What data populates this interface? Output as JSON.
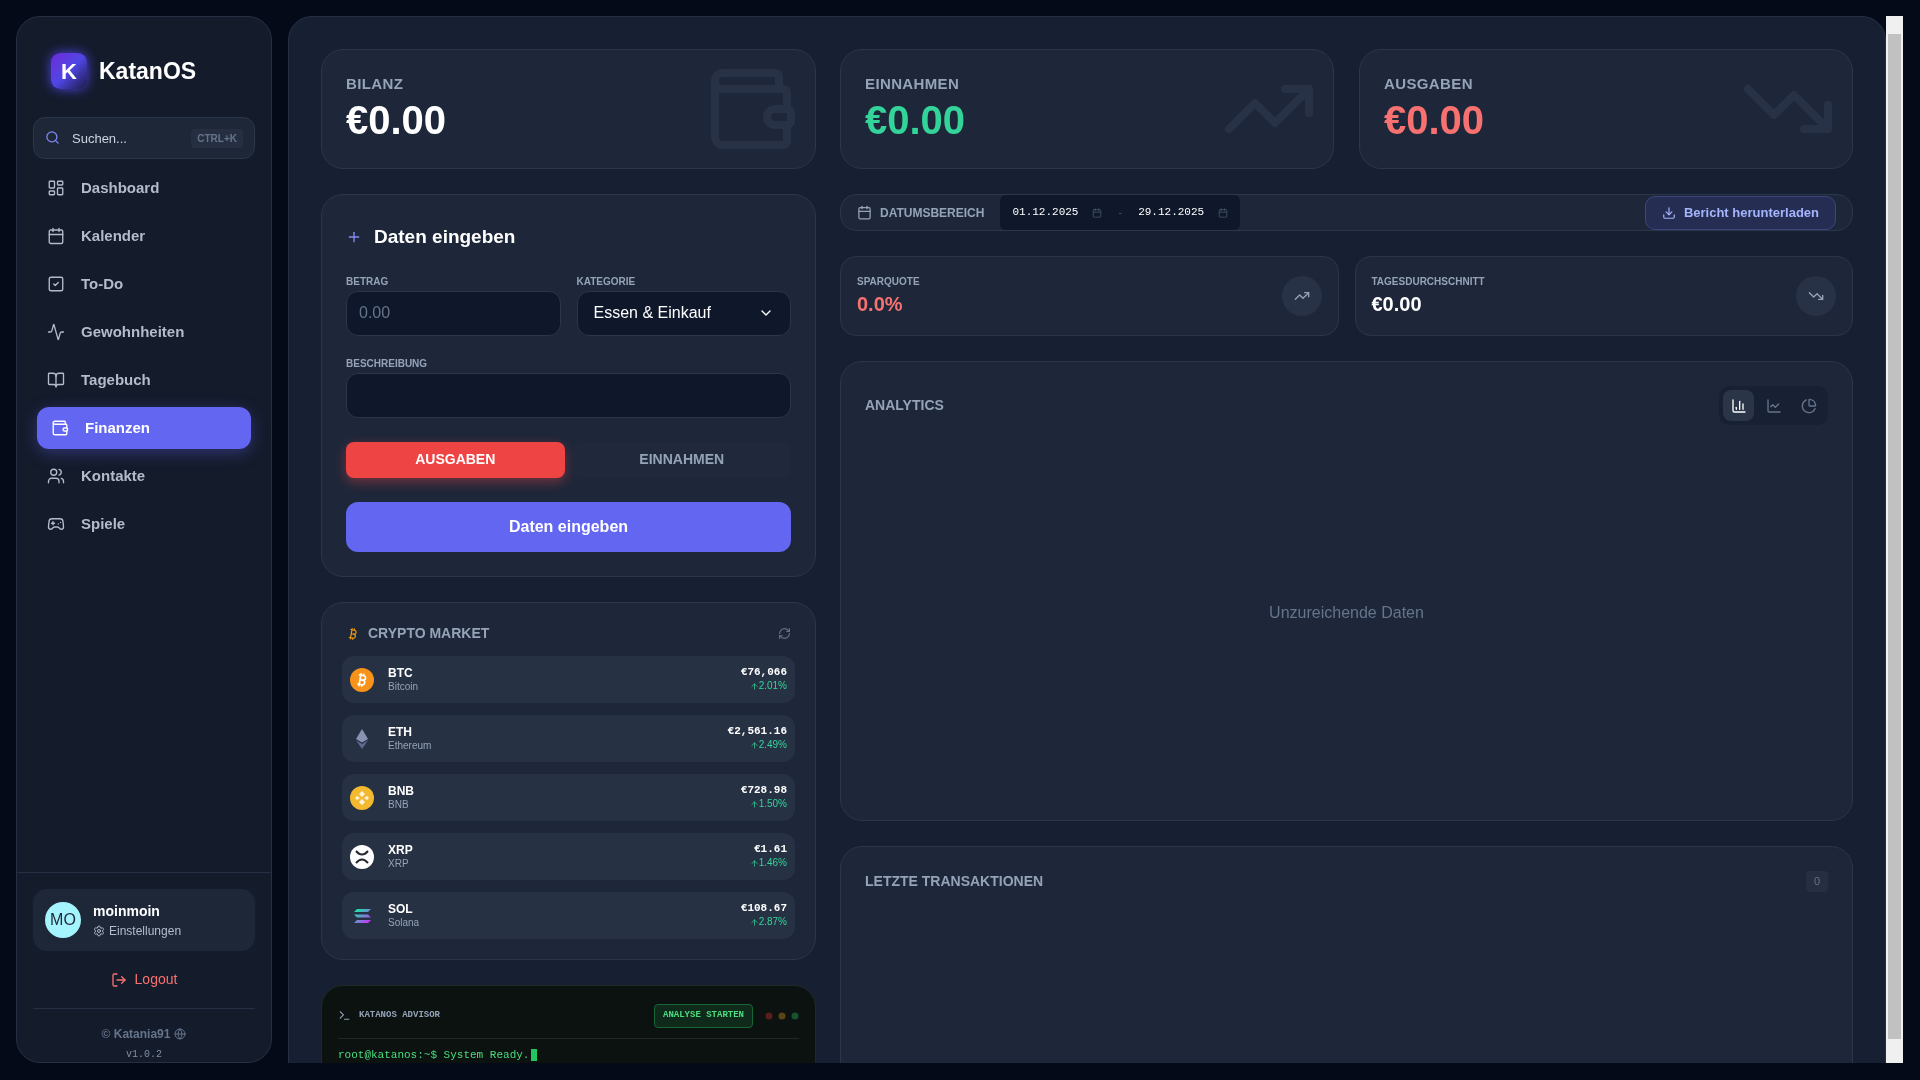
{
  "sidebar": {
    "brand": {
      "mark": "K",
      "name": "KatanOS"
    },
    "search": {
      "placeholder": "Suchen...",
      "shortcut": "CTRL+K"
    },
    "items": [
      {
        "label": "Dashboard",
        "selected": false
      },
      {
        "label": "Kalender",
        "selected": false
      },
      {
        "label": "To-Do",
        "selected": false
      },
      {
        "label": "Gewohnheiten",
        "selected": false
      },
      {
        "label": "Tagebuch",
        "selected": false
      },
      {
        "label": "Finanzen",
        "selected": true
      },
      {
        "label": "Kontakte",
        "selected": false
      },
      {
        "label": "Spiele",
        "selected": false
      }
    ],
    "user": {
      "initials": "MO",
      "name": "moinmoin",
      "settings": "Einstellungen"
    },
    "logout": "Logout",
    "credit": "© Katania91",
    "version": "v1.0.2"
  },
  "summary": [
    {
      "kind": "balance",
      "label": "BILANZ",
      "value": "€0.00"
    },
    {
      "kind": "income",
      "label": "EINNAHMEN",
      "value": "€0.00"
    },
    {
      "kind": "expense",
      "label": "AUSGABEN",
      "value": "€0.00"
    }
  ],
  "entry_form": {
    "title": "Daten eingeben",
    "amount": {
      "label": "BETRAG",
      "placeholder": "0.00"
    },
    "category": {
      "label": "KATEGORIE",
      "value": "Essen & Einkauf"
    },
    "description": {
      "label": "BESCHREIBUNG"
    },
    "types": [
      {
        "label": "AUSGABEN",
        "selected": true
      },
      {
        "label": "EINNAHMEN",
        "selected": false
      }
    ],
    "submit": "Daten eingeben"
  },
  "crypto": {
    "title": "CRYPTO MARKET",
    "coins": [
      {
        "symbol": "BTC",
        "name": "Bitcoin",
        "price": "€76,066",
        "change": "2.01%",
        "rising": true
      },
      {
        "symbol": "ETH",
        "name": "Ethereum",
        "price": "€2,561.16",
        "change": "2.49%",
        "rising": true
      },
      {
        "symbol": "BNB",
        "name": "BNB",
        "price": "€728.98",
        "change": "1.50%",
        "rising": true
      },
      {
        "symbol": "XRP",
        "name": "XRP",
        "price": "€1.61",
        "change": "1.46%",
        "rising": true
      },
      {
        "symbol": "SOL",
        "name": "Solana",
        "price": "€108.67",
        "change": "2.87%",
        "rising": true
      }
    ]
  },
  "advisor": {
    "title": "KATANOS ADVISOR",
    "button": "ANALYSE STARTEN",
    "line": "root@katanos:~$ System Ready."
  },
  "date_range": {
    "label": "DATUMSBEREICH",
    "from": "01.12.2025",
    "separator": "-",
    "to": "29.12.2025",
    "download": "Bericht herunterladen"
  },
  "stats": [
    {
      "kind": "up",
      "label": "SPARQUOTE",
      "value": "0.0%",
      "negative": true
    },
    {
      "kind": "down",
      "label": "TAGESDURCHSCHNITT",
      "value": "€0.00",
      "negative": false
    }
  ],
  "analytics": {
    "title": "ANALYTICS",
    "views": [
      {
        "kind": "bar",
        "selected": true
      },
      {
        "kind": "line",
        "selected": false
      },
      {
        "kind": "pie",
        "selected": false
      }
    ],
    "empty": "Unzureichende Daten"
  },
  "transactions": {
    "title": "LETZTE TRANSAKTIONEN",
    "count": "0"
  }
}
